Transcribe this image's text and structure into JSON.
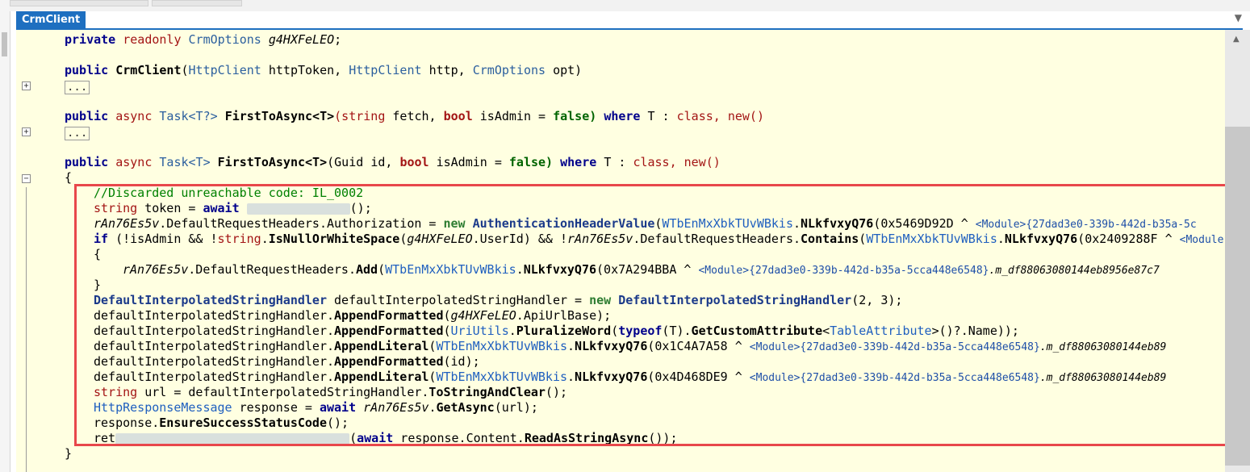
{
  "tab": {
    "title": "CrmClient"
  },
  "lines": {
    "l1": {
      "kw": "private",
      "mod": "readonly",
      "type": "CrmOptions",
      "name": "g4HXFeLEO",
      "end": ";"
    },
    "l2": {
      "kw": "public",
      "name": "CrmClient",
      "p1type": "HttpClient",
      "p1": "httpToken,",
      "p2type": "HttpClient",
      "p2": "http,",
      "p3type": "CrmOptions",
      "p3": "opt)"
    },
    "l2b": {
      "ellipsis": "..."
    },
    "l3": {
      "kw": "public",
      "async": "async",
      "ret": "Task<T?>",
      "name": "FirstToAsync<T>",
      "ptype": "(string",
      "p1": "fetch,",
      "btype": "bool",
      "p2": "isAdmin =",
      "val": "false)",
      "where": "where",
      "rest": "T :",
      "cls": "class,",
      "nw": "new()"
    },
    "l3b": {
      "ellipsis": "..."
    },
    "l4": {
      "kw": "public",
      "async": "async",
      "ret": "Task<T>",
      "name": "FirstToAsync<T>",
      "ptype": "(Guid",
      "p1": "id,",
      "btype": "bool",
      "p2": "isAdmin =",
      "val": "false)",
      "where": "where",
      "rest": "T :",
      "cls": "class,",
      "nw": "new()"
    },
    "l5": {
      "text": "{"
    },
    "c1": {
      "text": "//Discarded unreachable code: IL_0002"
    },
    "c2": {
      "t": "string",
      "a": " token = ",
      "aw": "await",
      "end": "();"
    },
    "c3": {
      "v": "rAn76Es5v",
      "a": ".DefaultRequestHeaders.Authorization = ",
      "nw": "new",
      "cls": "AuthenticationHeaderValue",
      "o": "(",
      "m": "WTbEnMxXbkTUvWBkis",
      "d": ".",
      "f": "NLkfvxyQ76",
      "arg": "(0x5469D92D ^ ",
      "mod": "<Module>{27dad3e0-339b-442d-b35a-5c"
    },
    "c4": {
      "kw": "if",
      "a": " (!isAdmin && !",
      "s": "string",
      "d": ".",
      "m": "IsNullOrWhiteSpace",
      "o": "(",
      "v": "g4HXFeLEO",
      "u": ".UserId) && !",
      "v2": "rAn76Es5v",
      "r": ".DefaultRequestHeaders.",
      "c": "Contains",
      "o2": "(",
      "w": "WTbEnMxXbkTUvWBkis",
      "d2": ".",
      "f": "NLkfvxyQ76",
      "arg": "(0x2409288F ^ ",
      "mod": "<Module"
    },
    "c5": {
      "text": "{"
    },
    "c6": {
      "v": "rAn76Es5v",
      "a": ".DefaultRequestHeaders.",
      "m": "Add",
      "o": "(",
      "w": "WTbEnMxXbkTUvWBkis",
      "d": ".",
      "f": "NLkfvxyQ76",
      "arg": "(0x7A294BBA ^ ",
      "mod": "<Module>{27dad3e0-339b-442d-b35a-5cca448e6548}",
      "tail": ".m_df88063080144eb8956e87c7"
    },
    "c7": {
      "text": "}"
    },
    "c8": {
      "t": "DefaultInterpolatedStringHandler",
      "a": " defaultInterpolatedStringHandler = ",
      "nw": "new",
      "t2": "DefaultInterpolatedStringHandler",
      "args": "(2, 3);"
    },
    "c9": {
      "a": "defaultInterpolatedStringHandler.",
      "m": "AppendFormatted",
      "o": "(",
      "v": "g4HXFeLEO",
      "e": ".ApiUrlBase);"
    },
    "c10": {
      "a": "defaultInterpolatedStringHandler.",
      "m": "AppendFormatted",
      "o": "(",
      "u": "UriUtils",
      "d": ".",
      "p": "PluralizeWord",
      "o2": "(",
      "to": "typeof",
      "t": "(T).",
      "g": "GetCustomAttribute",
      "lt": "<",
      "ta": "TableAttribute",
      "e": ">()?.Name));"
    },
    "c11": {
      "a": "defaultInterpolatedStringHandler.",
      "m": "AppendLiteral",
      "o": "(",
      "w": "WTbEnMxXbkTUvWBkis",
      "d": ".",
      "f": "NLkfvxyQ76",
      "arg": "(0x1C4A7A58 ^ ",
      "mod": "<Module>{27dad3e0-339b-442d-b35a-5cca448e6548}",
      "tail": ".m_df88063080144eb89"
    },
    "c12": {
      "a": "defaultInterpolatedStringHandler.",
      "m": "AppendFormatted",
      "e": "(id);"
    },
    "c13": {
      "a": "defaultInterpolatedStringHandler.",
      "m": "AppendLiteral",
      "o": "(",
      "w": "WTbEnMxXbkTUvWBkis",
      "d": ".",
      "f": "NLkfvxyQ76",
      "arg": "(0x4D468DE9 ^ ",
      "mod": "<Module>{27dad3e0-339b-442d-b35a-5cca448e6548}",
      "tail": ".m_df88063080144eb89"
    },
    "c14": {
      "t": "string",
      "a": " url = defaultInterpolatedStringHandler.",
      "m": "ToStringAndClear",
      "e": "();"
    },
    "c15": {
      "t": "HttpResponseMessage",
      "a": " response = ",
      "aw": "await",
      "v": " rAn76Es5v",
      "d": ".",
      "m": "GetAsync",
      "e": "(url);"
    },
    "c16": {
      "a": "response.",
      "m": "EnsureSuccessStatusCode",
      "e": "();"
    },
    "c17": {
      "pre": "ret",
      "aw": "await",
      "a": " response.Content.",
      "m": "ReadAsStringAsync",
      "e": "());"
    },
    "l6": {
      "text": "}"
    }
  },
  "fold": {
    "plus": "+",
    "minus": "−"
  },
  "scroll": {
    "up": "▲",
    "menu": "▼"
  }
}
